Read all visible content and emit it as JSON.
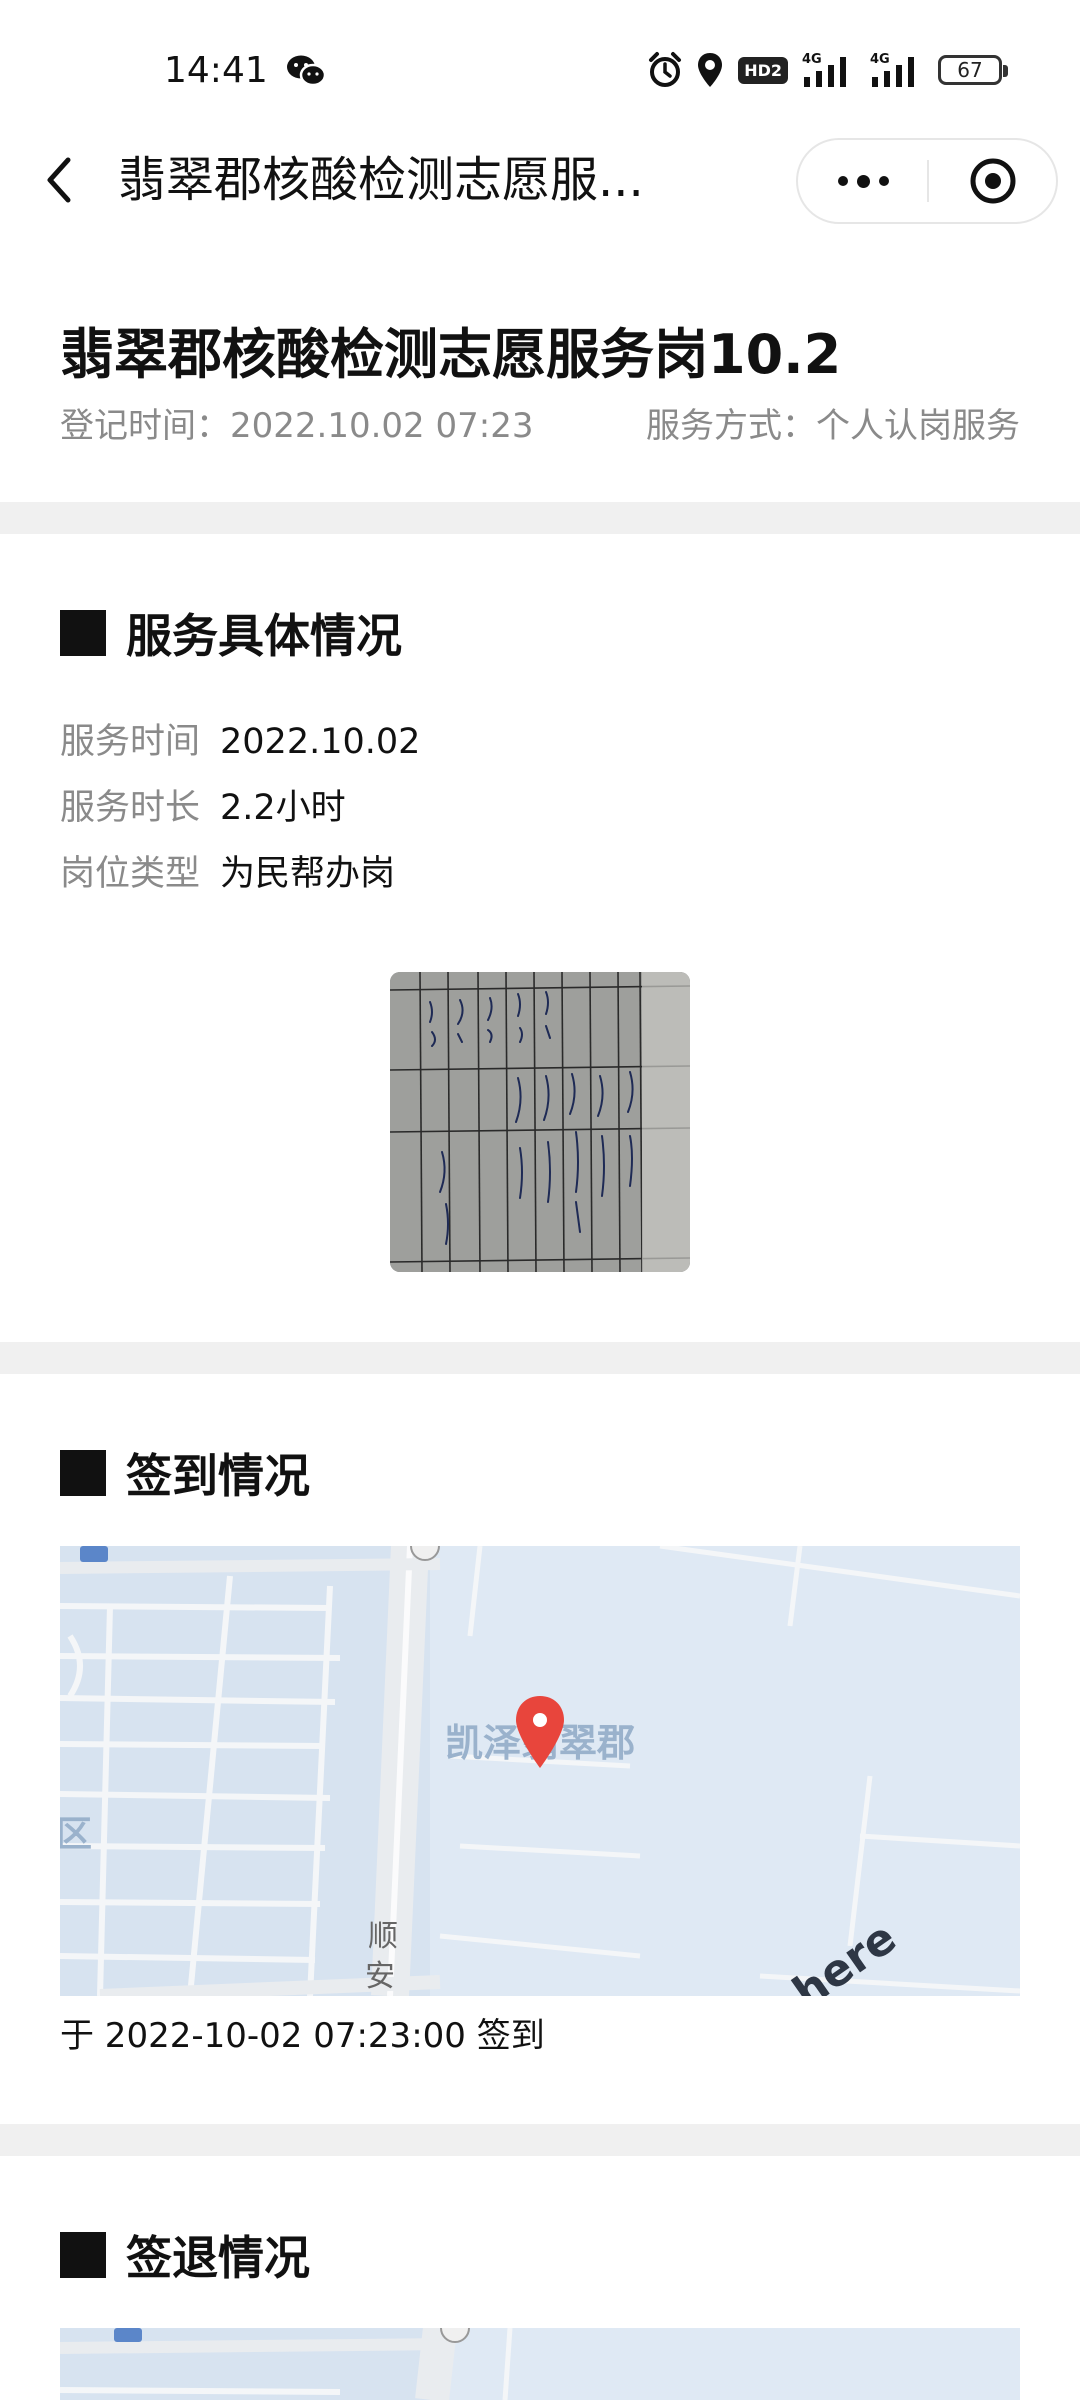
{
  "status_bar": {
    "time": "14:41",
    "icons": [
      "wechat-icon",
      "alarm-icon",
      "location-icon",
      "hd-icon",
      "signal-icon",
      "signal-icon"
    ],
    "hd_label": "HD2",
    "network_1": "4G",
    "network_2": "4G",
    "battery": "67"
  },
  "nav": {
    "back_icon": "chevron-left-icon",
    "title": "翡翠郡核酸检测志愿服...",
    "more_icon": "more-dots-icon",
    "close_icon": "target-icon"
  },
  "header": {
    "title": "翡翠郡核酸检测志愿服务岗10.2",
    "reg_time": "登记时间：2022.10.02 07:23",
    "service_mode": "服务方式：个人认岗服务"
  },
  "service_section": {
    "heading": "服务具体情况",
    "rows": [
      {
        "label": "服务时间",
        "value": "2022.10.02"
      },
      {
        "label": "服务时长",
        "value": "2.2小时"
      },
      {
        "label": "岗位类型",
        "value": "为民帮办岗"
      }
    ],
    "photo_icon": "document-photo-icon"
  },
  "checkin_section": {
    "heading": "签到情况",
    "map_labels": {
      "place": "凯泽翡翠郡",
      "district": "区",
      "road_1": "顺",
      "road_2": "安",
      "watermark": "here"
    },
    "checkin_text": "于 2022-10-02 07:23:00 签到"
  },
  "checkout_section": {
    "heading": "签退情况"
  },
  "colors": {
    "background": "#ffffff",
    "divider_band": "#f0f0f0",
    "muted_text": "#8a8a8a",
    "map_water": "#dfe9f4",
    "map_land": "#e9ecef",
    "pin": "#e8453c"
  }
}
